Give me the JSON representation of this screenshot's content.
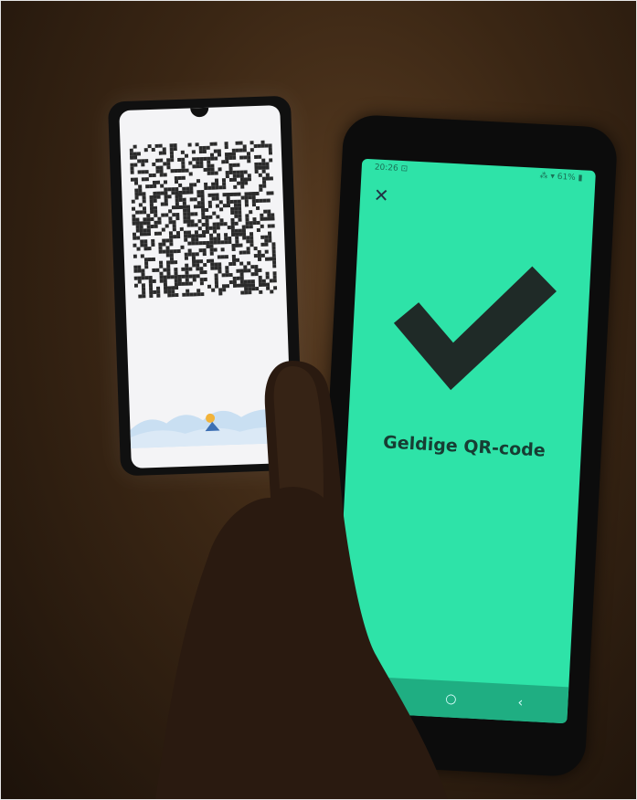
{
  "scene": {
    "description_free": true
  },
  "left_phone": {
    "icon": "qr-code-icon"
  },
  "right_phone": {
    "status_time": "20:26 ⊡",
    "status_icons": "⁂ ▾ 61% ▮",
    "close_label": "✕",
    "check_icon": "checkmark-icon",
    "result_text": "Geldige QR-code",
    "nav": {
      "recents": "|||",
      "home": "○",
      "back": "‹"
    },
    "screen_color": "#2ee3a8",
    "check_color": "#1f2a27"
  }
}
